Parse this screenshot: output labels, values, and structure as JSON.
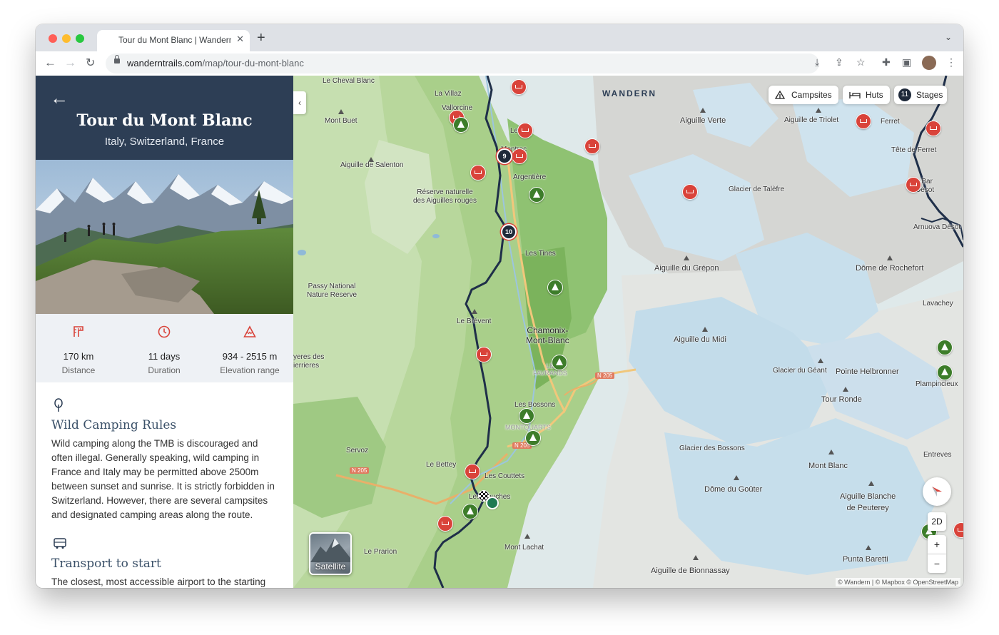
{
  "browser": {
    "tab_title": "Tour du Mont Blanc | Wandern",
    "url_domain": "wanderntrails.com",
    "url_path": "/map/tour-du-mont-blanc"
  },
  "trail": {
    "title": "Tour du Mont Blanc",
    "subtitle": "Italy, Switzerland, France",
    "stats": [
      {
        "icon": "distance-icon",
        "value": "170 km",
        "label": "Distance"
      },
      {
        "icon": "clock-icon",
        "value": "11 days",
        "label": "Duration"
      },
      {
        "icon": "elevation-icon",
        "value": "934 - 2515 m",
        "label": "Elevation range"
      }
    ],
    "sections": [
      {
        "icon": "tree-icon",
        "title": "Wild Camping Rules",
        "body": "Wild camping along the TMB is discouraged and often illegal. Generally speaking, wild camping in France and Italy may be permitted above 2500m between sunset and sunrise. It is strictly forbidden in Switzerland. However, there are several campsites and designated camping areas along the route."
      },
      {
        "icon": "bus-icon",
        "title": "Transport to start",
        "body": "The closest, most accessible airport to the starting"
      }
    ]
  },
  "map": {
    "brand": "WANDERN",
    "filters": {
      "campsites": "Campsites",
      "huts": "Huts",
      "stages_count": "11",
      "stages": "Stages"
    },
    "satellite": "Satellite",
    "view_toggle": "2D",
    "zoom_in": "+",
    "zoom_out": "−",
    "attribution": "© Wandern | © Mapbox © OpenStreetMap",
    "stage_markers": [
      "9",
      "10"
    ],
    "labels": {
      "le_cheval_blanc": "Le Cheval Blanc",
      "la_villaz": "La Villaz",
      "vallorcine": "Vallorcine",
      "mont_buet": "Mont Buet",
      "le_tour": "Le",
      "montroc": "Montroc",
      "aiguille_de_salenton": "Aiguille de Salenton",
      "argentiere": "Argentière",
      "reserve": "Réserve naturelle\ndes Aiguilles rouges",
      "aiguille_verte": "Aiguille Verte",
      "aiguille_de_triolet": "Aiguille de Triolet",
      "ferret": "Ferret",
      "tete_de_ferret": "Tête de Ferret",
      "pre_bar": "Pré Bar",
      "desot": "Désot",
      "arnuova": "Arnuova Désot",
      "glacier_de_talefre": "Glacier de Talèfre",
      "les_tines": "Les Tines",
      "aiguille_du_grepon": "Aiguille du Grépon",
      "dome_de_rochefort": "Dôme de Rochefort",
      "passy": "Passy National\nNature Reserve",
      "lavachey": "Lavachey",
      "le_brevent": "Le Brévent",
      "chamonix": "Chamonix-\nMont-Blanc",
      "aiguille_du_midi": "Aiguille du Midi",
      "favrands": "LE\nFAVRANDS",
      "n205a": "N 205",
      "glacier_du_geant": "Glacier du Géant",
      "pointe_helbronner": "Pointe Helbronner",
      "plampincieux": "Plampincieux",
      "reserves": "yeres des\nierrieres",
      "les_bossons": "Les Bossons",
      "montquarts": "MONTQUARTS",
      "tour_ronde": "Tour Ronde",
      "servoz": "Servoz",
      "n205b": "N 205",
      "n205c": "N 205",
      "glacier_des_bossons": "Glacier des Bossons",
      "entreves": "Entreves",
      "le_bettey": "Le Bettey",
      "les_couttets": "Les Couttets",
      "mont_blanc": "Mont Blanc",
      "les_houches": "Les Houches",
      "dome_du_gouter": "Dôme du Goûter",
      "aiguille_blanche": "Aiguille Blanche\nde Peuterey",
      "le_prarion": "Le Prarion",
      "mont_lachat": "Mont Lachat",
      "punta_baretti": "Punta Baretti",
      "aiguille_de_bionnassay": "Aiguille de Bionnassay"
    }
  }
}
